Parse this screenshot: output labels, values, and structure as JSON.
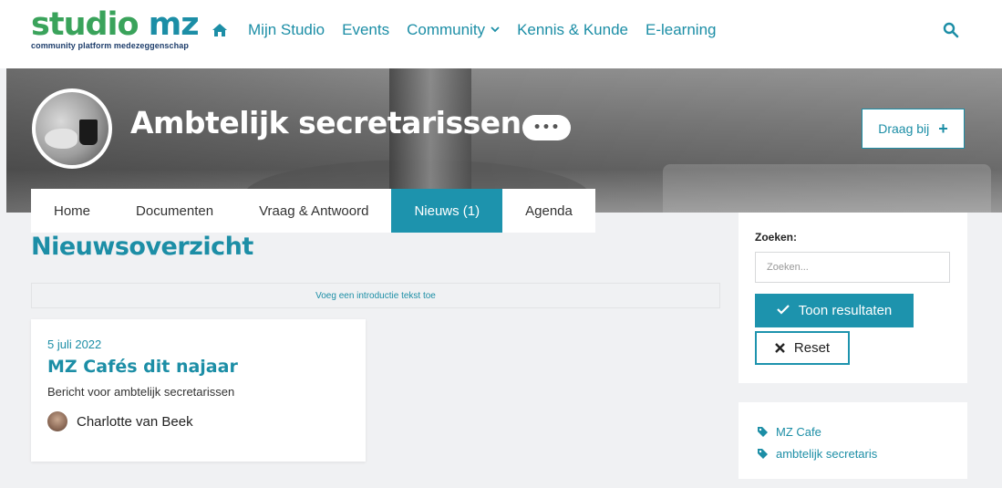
{
  "brand": {
    "logo_part1": "studio",
    "logo_part2": "mz",
    "tagline": "community platform medezeggenschap"
  },
  "nav": {
    "items": [
      {
        "label": "Mijn Studio"
      },
      {
        "label": "Events"
      },
      {
        "label": "Community",
        "has_dropdown": true
      },
      {
        "label": "Kennis & Kunde"
      },
      {
        "label": "E-learning"
      }
    ],
    "dropdown_glyph": "⌄"
  },
  "hero": {
    "title": "Ambtelijk secretarissen",
    "more_label": "•••",
    "contribute_label": "Draag bij",
    "contribute_icon": "+"
  },
  "tabs": [
    {
      "label": "Home",
      "active": false
    },
    {
      "label": "Documenten",
      "active": false
    },
    {
      "label": "Vraag & Antwoord",
      "active": false
    },
    {
      "label": "Nieuws  (1)",
      "active": true
    },
    {
      "label": "Agenda",
      "active": false
    }
  ],
  "main": {
    "title": "Nieuwsoverzicht",
    "intro_prompt": "Voeg een introductie tekst toe",
    "news": [
      {
        "date": "5 juli 2022",
        "title": "MZ Cafés dit najaar",
        "excerpt": "Bericht voor ambtelijk secretarissen",
        "author": "Charlotte van Beek"
      }
    ]
  },
  "sidebar": {
    "search_label": "Zoeken:",
    "search_placeholder": "Zoeken...",
    "submit_label": "Toon resultaten",
    "submit_icon": "✓",
    "reset_label": "Reset",
    "reset_icon": "✖",
    "tags": [
      {
        "label": "MZ Cafe"
      },
      {
        "label": "ambtelijk secretaris"
      }
    ]
  },
  "colors": {
    "brand_teal": "#1c8ea6",
    "brand_green": "#3aa35b",
    "active_tab": "#1d93ad"
  }
}
